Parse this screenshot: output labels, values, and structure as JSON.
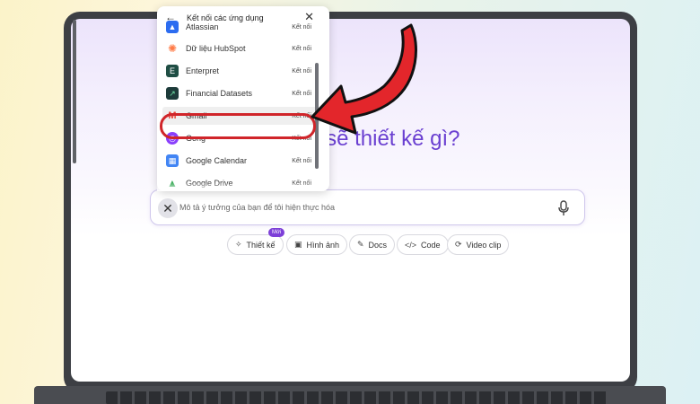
{
  "popup": {
    "title": "Kết nối các ứng dụng",
    "items": [
      {
        "name": "Atlassian",
        "action": "Kết nối",
        "icon": "atlassian-icon",
        "color": "#2c6cf0"
      },
      {
        "name": "Dữ liệu HubSpot",
        "action": "Kết nối",
        "icon": "hubspot-icon",
        "color": "#ff7a45"
      },
      {
        "name": "Enterpret",
        "action": "Kết nối",
        "icon": "enterpret-icon",
        "color": "#1f4e44"
      },
      {
        "name": "Financial Datasets",
        "action": "Kết nối",
        "icon": "financial-datasets-icon",
        "color": "#1d3b3a"
      },
      {
        "name": "Gmail",
        "action": "Kết nối",
        "icon": "gmail-icon",
        "color": "#ea4335"
      },
      {
        "name": "Gong",
        "action": "Kết nối",
        "icon": "gong-icon",
        "color": "#8a3ffc"
      },
      {
        "name": "Google Calendar",
        "action": "Kết nối",
        "icon": "google-calendar-icon",
        "color": "#4285f4"
      },
      {
        "name": "Google Drive",
        "action": "Kết nối",
        "icon": "google-drive-icon",
        "color": "#34a853"
      }
    ]
  },
  "main": {
    "headline": "Chúng ta sẽ thiết kế gì?",
    "prompt_placeholder": "Mô tả ý tưởng của bạn để tôi hiện thực hóa"
  },
  "modes": [
    {
      "label": "Thiết kế",
      "icon": "sparkle-icon",
      "badge": "Mới"
    },
    {
      "label": "Hình ảnh",
      "icon": "image-icon"
    },
    {
      "label": "Docs",
      "icon": "docs-icon"
    },
    {
      "label": "Code",
      "icon": "code-icon"
    },
    {
      "label": "Video clip",
      "icon": "video-icon"
    }
  ],
  "colors": {
    "accent": "#6a3fd1",
    "highlight": "#d0252a",
    "arrow": "#e3262b",
    "badge": "#7d3fd8"
  }
}
